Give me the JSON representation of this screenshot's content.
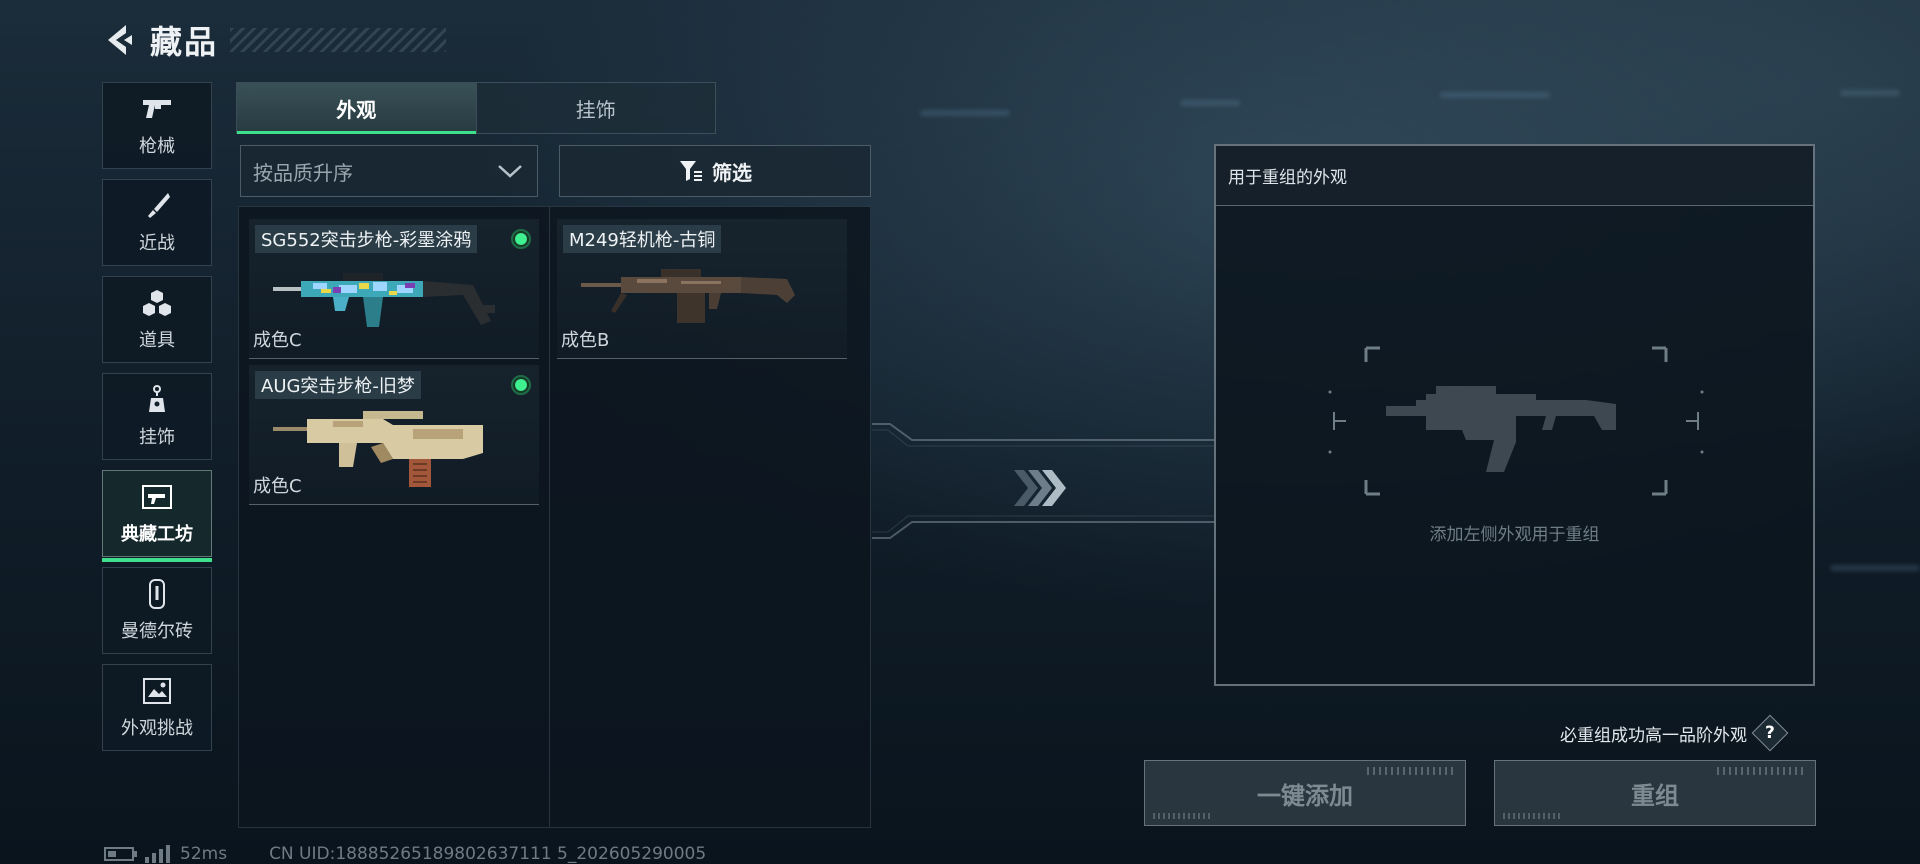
{
  "header": {
    "title": "藏品"
  },
  "categories": [
    {
      "label": "枪械",
      "icon": "pistol-icon"
    },
    {
      "label": "近战",
      "icon": "knife-icon"
    },
    {
      "label": "道具",
      "icon": "grenades-icon"
    },
    {
      "label": "挂饰",
      "icon": "charm-icon"
    },
    {
      "label": "典藏工坊",
      "icon": "workshop-icon"
    },
    {
      "label": "曼德尔砖",
      "icon": "mandel-brick-icon"
    },
    {
      "label": "外观挑战",
      "icon": "challenge-icon"
    }
  ],
  "active_category": "典藏工坊",
  "tabs": [
    {
      "label": "外观"
    },
    {
      "label": "挂饰"
    }
  ],
  "active_tab": "外观",
  "sort": {
    "value": "按品质升序"
  },
  "filter": {
    "label": "筛选"
  },
  "items": [
    {
      "name": "SG552突击步枪-彩墨涂鸦",
      "grade": "成色C",
      "owned": true
    },
    {
      "name": "M249轻机枪-古铜",
      "grade": "成色B",
      "owned": false
    },
    {
      "name": "AUG突击步枪-旧梦",
      "grade": "成色C",
      "owned": true
    }
  ],
  "recompose": {
    "panel_title": "用于重组的外观",
    "slot_hint": "添加左侧外观用于重组",
    "guarantee_text": "必重组成功高一品阶外观",
    "help_label": "?",
    "add_all_label": "一键添加",
    "recompose_label": "重组"
  },
  "status": {
    "ping": "52ms",
    "uid": "CN UID:18885265189802637111 5_202605290005"
  },
  "colors": {
    "accent": "#3ee08b",
    "owned_dot": "#3ff08f"
  }
}
